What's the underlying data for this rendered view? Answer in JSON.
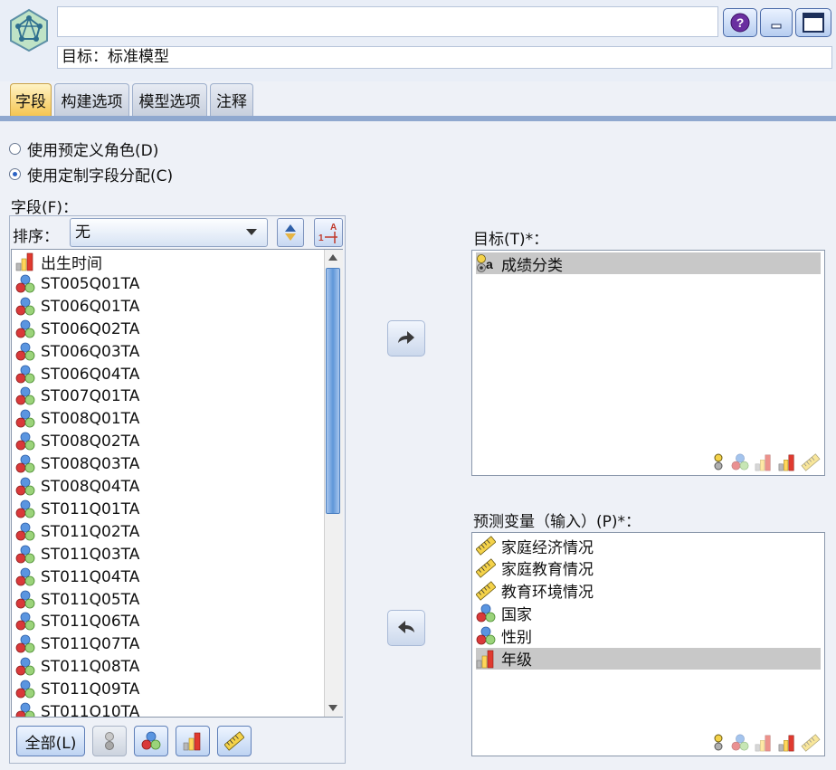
{
  "header": {
    "name_value": "",
    "target_line": "目标：标准模型"
  },
  "tabs": [
    {
      "label": "字段",
      "active": true
    },
    {
      "label": "构建选项",
      "active": false
    },
    {
      "label": "模型选项",
      "active": false
    },
    {
      "label": "注释",
      "active": false
    }
  ],
  "roles": {
    "predefined": "使用预定义角色(D)",
    "custom": "使用定制字段分配(C)",
    "selected": "custom"
  },
  "fields": {
    "label": "字段(F)：",
    "sort_label": "排序：",
    "sort_value": "无",
    "items": [
      {
        "name": "出生时间",
        "icon": "ordinal-icon"
      },
      {
        "name": "ST005Q01TA",
        "icon": "nominal-icon"
      },
      {
        "name": "ST006Q01TA",
        "icon": "nominal-icon"
      },
      {
        "name": "ST006Q02TA",
        "icon": "nominal-icon"
      },
      {
        "name": "ST006Q03TA",
        "icon": "nominal-icon"
      },
      {
        "name": "ST006Q04TA",
        "icon": "nominal-icon"
      },
      {
        "name": "ST007Q01TA",
        "icon": "nominal-icon"
      },
      {
        "name": "ST008Q01TA",
        "icon": "nominal-icon"
      },
      {
        "name": "ST008Q02TA",
        "icon": "nominal-icon"
      },
      {
        "name": "ST008Q03TA",
        "icon": "nominal-icon"
      },
      {
        "name": "ST008Q04TA",
        "icon": "nominal-icon"
      },
      {
        "name": "ST011Q01TA",
        "icon": "nominal-icon"
      },
      {
        "name": "ST011Q02TA",
        "icon": "nominal-icon"
      },
      {
        "name": "ST011Q03TA",
        "icon": "nominal-icon"
      },
      {
        "name": "ST011Q04TA",
        "icon": "nominal-icon"
      },
      {
        "name": "ST011Q05TA",
        "icon": "nominal-icon"
      },
      {
        "name": "ST011Q06TA",
        "icon": "nominal-icon"
      },
      {
        "name": "ST011Q07TA",
        "icon": "nominal-icon"
      },
      {
        "name": "ST011Q08TA",
        "icon": "nominal-icon"
      },
      {
        "name": "ST011Q09TA",
        "icon": "nominal-icon"
      },
      {
        "name": "ST011Q10TA",
        "icon": "nominal-icon"
      }
    ],
    "all_button": "全部(L)"
  },
  "target": {
    "label": "目标(T)*：",
    "items": [
      {
        "name": "成绩分类",
        "icon": "flag-icon",
        "selected": true
      }
    ]
  },
  "predictors": {
    "label": "预测变量（输入）(P)*：",
    "items": [
      {
        "name": "家庭经济情况",
        "icon": "continuous-icon",
        "selected": false
      },
      {
        "name": "家庭教育情况",
        "icon": "continuous-icon",
        "selected": false
      },
      {
        "name": "教育环境情况",
        "icon": "continuous-icon",
        "selected": false
      },
      {
        "name": "国家",
        "icon": "nominal-icon",
        "selected": false
      },
      {
        "name": "性别",
        "icon": "nominal-icon",
        "selected": false
      },
      {
        "name": "年级",
        "icon": "ordinal-icon",
        "selected": true
      }
    ]
  },
  "colors": {
    "tab_active": "#f5c552",
    "selection": "#c8c8c8",
    "accent": "#2b63c4"
  }
}
